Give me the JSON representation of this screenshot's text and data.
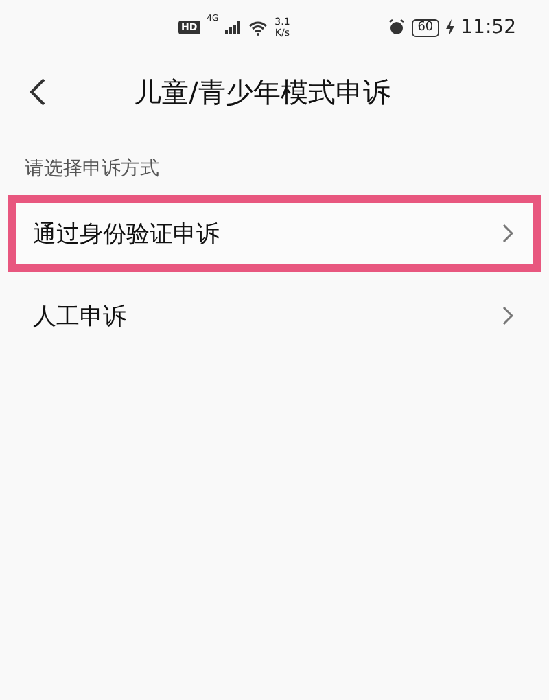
{
  "status_bar": {
    "hd": "HD",
    "network": "4G",
    "speed": "3.1",
    "speed_unit": "K/s",
    "battery": "60",
    "time": "11:52"
  },
  "header": {
    "title": "儿童/青少年模式申诉"
  },
  "section_label": "请选择申诉方式",
  "options": [
    {
      "label": "通过身份验证申诉",
      "highlighted": true
    },
    {
      "label": "人工申诉",
      "highlighted": false
    }
  ]
}
